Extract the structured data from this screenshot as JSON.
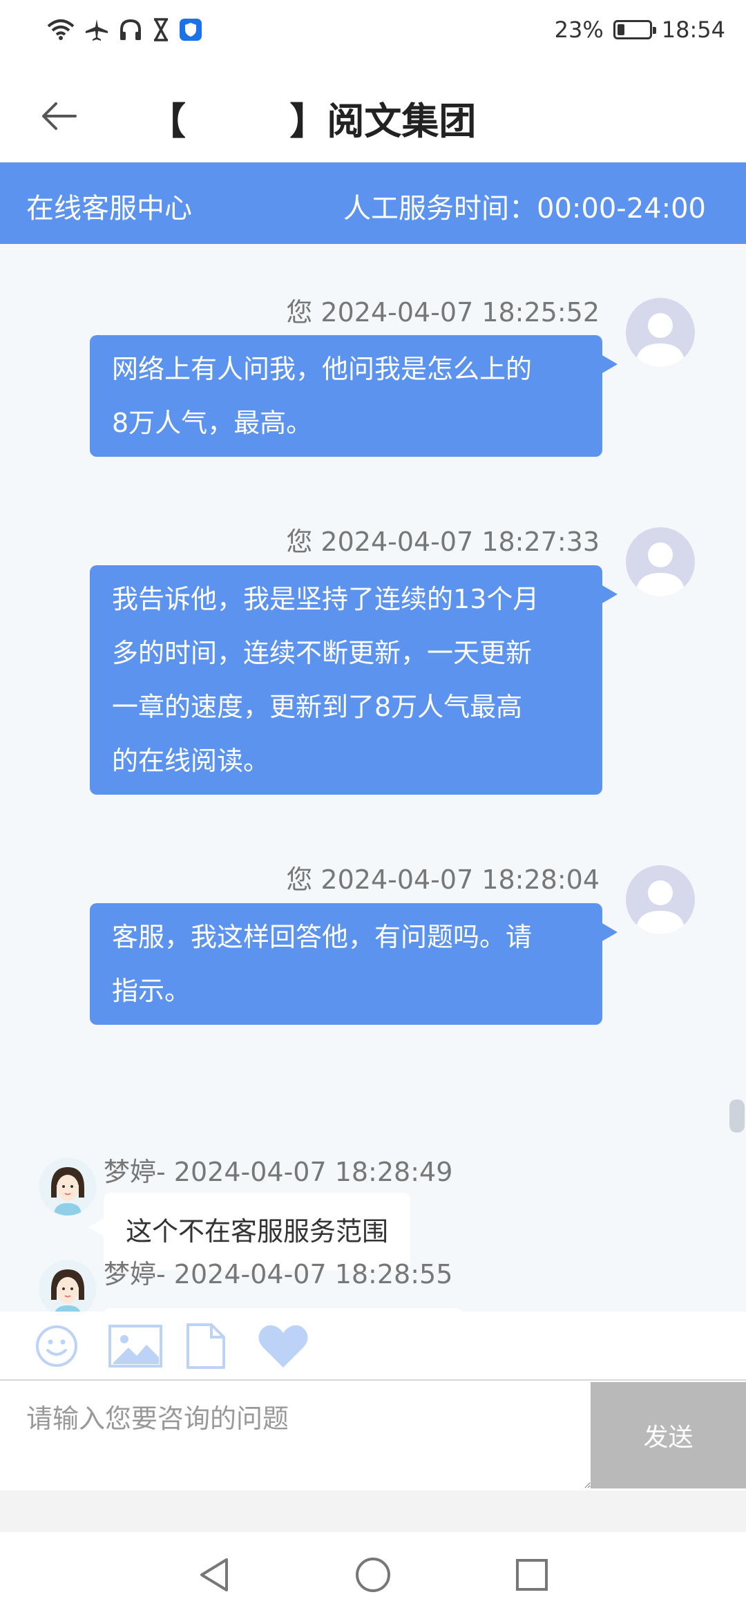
{
  "status_bar": {
    "battery_percent": "23%",
    "battery_level": 0.23,
    "time": "18:54",
    "icons": [
      "wifi-icon",
      "airplane-icon",
      "headphones-icon",
      "hourglass-icon",
      "shield-app-icon"
    ]
  },
  "title_bar": {
    "back_icon": "back-arrow-icon",
    "title": "【        】阅文集团"
  },
  "service_header": {
    "center_label": "在线客服中心",
    "hours_label": "人工服务时间：00:00-24:00"
  },
  "messages": [
    {
      "sender": "user",
      "meta": "您 2024-04-07 18:25:52",
      "lines": [
        "网络上有人问我，他问我是怎么上的",
        "8万人气，最高。"
      ]
    },
    {
      "sender": "user",
      "meta": "您 2024-04-07 18:27:33",
      "lines": [
        "我告诉他，我是坚持了连续的13个月",
        "多的时间，连续不断更新，一天更新",
        "一章的速度，更新到了8万人气最高",
        "的在线阅读。"
      ]
    },
    {
      "sender": "user",
      "meta": "您 2024-04-07 18:28:04",
      "lines": [
        "客服，我这样回答他，有问题吗。请",
        "指示。"
      ]
    },
    {
      "sender": "agent",
      "meta": "梦婷- 2024-04-07 18:28:49",
      "text": "这个不在客服服务范围"
    },
    {
      "sender": "agent",
      "meta": "梦婷- 2024-04-07 18:28:55",
      "text": ""
    }
  ],
  "toolbar": {
    "tools": [
      "emoji-icon",
      "image-icon",
      "file-icon",
      "heart-icon"
    ],
    "accent_color": "#bcd3f7"
  },
  "input": {
    "placeholder": "请输入您要咨询的问题",
    "value": "",
    "send_label": "发送"
  },
  "nav": {
    "buttons": [
      "back-triangle-icon",
      "home-circle-icon",
      "recents-square-icon"
    ]
  },
  "colors": {
    "brand_blue": "#5b93ef",
    "chat_bg": "#f4f8fb",
    "send_button_bg": "#b9b9b9"
  }
}
